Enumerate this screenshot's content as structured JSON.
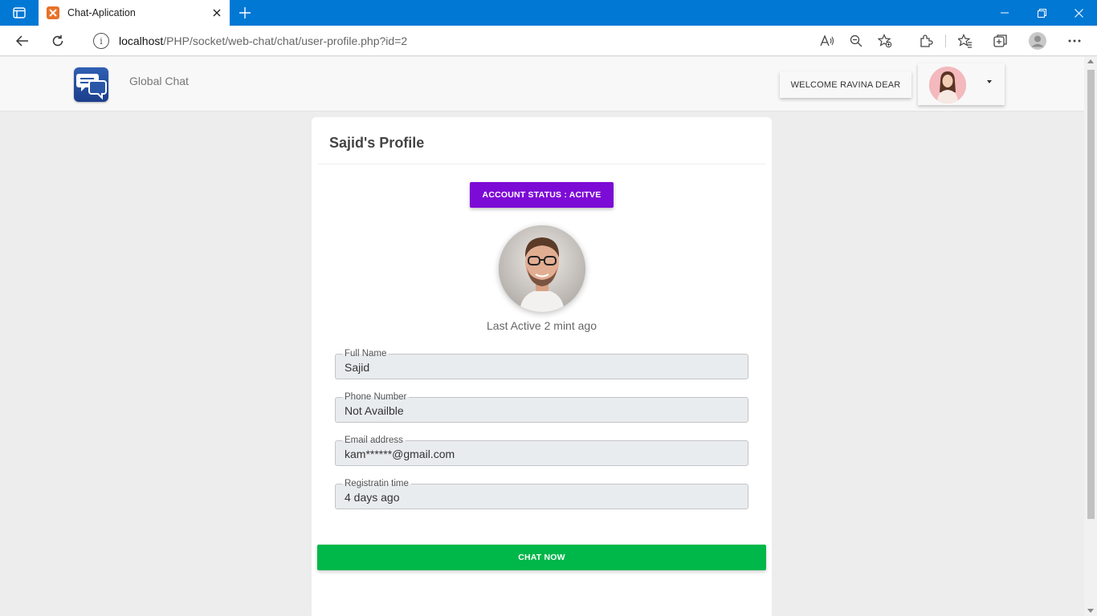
{
  "browser": {
    "tab_title": "Chat-Aplication",
    "address_host": "localhost",
    "address_path": "/PHP/socket/web-chat/chat/user-profile.php?id=2",
    "icons": [
      "tab-actions-icon",
      "close-icon",
      "plus-icon",
      "minimize-icon",
      "restore-icon",
      "window-close-icon",
      "back-icon",
      "refresh-icon",
      "info-icon",
      "read-aloud-icon",
      "zoom-out-icon",
      "add-favorite-icon",
      "extensions-icon",
      "favorites-icon",
      "collections-icon",
      "profile-icon",
      "more-icon"
    ]
  },
  "navbar": {
    "brand": "Global Chat",
    "welcome": "WELCOME RAVINA DEAR"
  },
  "profile": {
    "title": "Sajid's Profile",
    "status": "ACCOUNT STATUS : ACITVE",
    "last_active": "Last Active 2 mint ago",
    "fields": [
      {
        "label": "Full Name",
        "value": "Sajid"
      },
      {
        "label": "Phone Number",
        "value": "Not Availble"
      },
      {
        "label": "Email address",
        "value": "kam******@gmail.com"
      },
      {
        "label": "Registratin time",
        "value": "4 days ago"
      }
    ],
    "chat_button": "CHAT NOW"
  },
  "colors": {
    "titlebar": "#0078d4",
    "status_button": "#7d0bd6",
    "chat_button": "#00b74a"
  }
}
